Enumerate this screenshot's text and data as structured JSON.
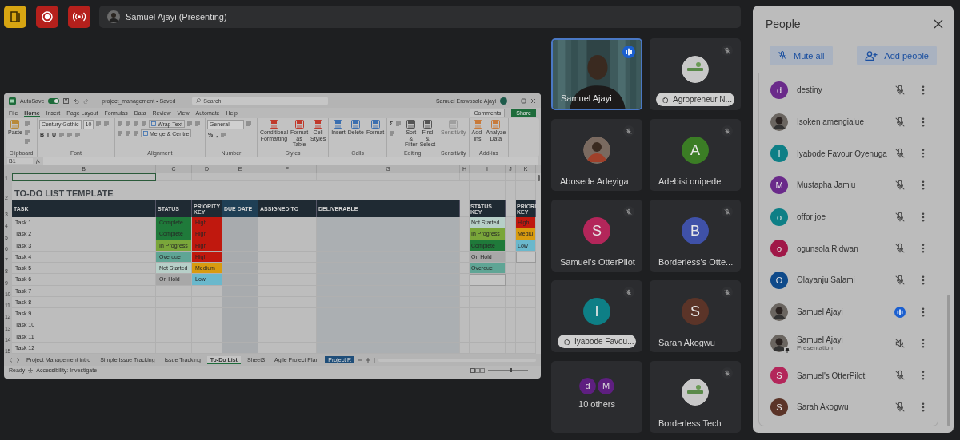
{
  "top_bar": {
    "presenter": "Samuel Ajayi (Presenting)"
  },
  "shared_screen": {
    "title_bar": {
      "autosave": "AutoSave",
      "autosave_on": true,
      "file_name": "project_management • Saved",
      "search_placeholder": "Search",
      "user": "Samuel Erowosale Ajayi"
    },
    "menu_tabs": [
      {
        "label": "File",
        "selected": false
      },
      {
        "label": "Home",
        "selected": true
      },
      {
        "label": "Insert",
        "selected": false
      },
      {
        "label": "Page Layout",
        "selected": false
      },
      {
        "label": "Formulas",
        "selected": false
      },
      {
        "label": "Data",
        "selected": false
      },
      {
        "label": "Review",
        "selected": false
      },
      {
        "label": "View",
        "selected": false
      },
      {
        "label": "Automate",
        "selected": false
      },
      {
        "label": "Help",
        "selected": false
      }
    ],
    "comments": "Comments",
    "share": "Share",
    "ribbon": [
      {
        "name": "Clipboard",
        "disabled": false,
        "items": [
          {
            "kind": "large",
            "label": "Paste"
          },
          {
            "kind": "icon"
          },
          {
            "kind": "icon"
          },
          {
            "kind": "icon"
          }
        ]
      },
      {
        "name": "Font",
        "disabled": false,
        "items": [
          {
            "kind": "dropdown",
            "label": "Century Gothic"
          },
          {
            "kind": "dropdown",
            "label": "10"
          },
          {
            "kind": "icon"
          },
          {
            "kind": "icon"
          },
          {
            "kind": "toggle",
            "label": "B"
          },
          {
            "kind": "toggle",
            "label": "I"
          },
          {
            "kind": "toggle",
            "label": "U"
          },
          {
            "kind": "icon"
          },
          {
            "kind": "icon"
          },
          {
            "kind": "icon"
          }
        ]
      },
      {
        "name": "Alignment",
        "disabled": false,
        "items": [
          {
            "kind": "icon"
          },
          {
            "kind": "icon"
          },
          {
            "kind": "icon"
          },
          {
            "kind": "icon"
          },
          {
            "kind": "small",
            "label": "Wrap Text"
          },
          {
            "kind": "icon"
          },
          {
            "kind": "icon"
          },
          {
            "kind": "icon"
          },
          {
            "kind": "icon"
          },
          {
            "kind": "icon"
          },
          {
            "kind": "small",
            "label": "Merge & Centre"
          }
        ]
      },
      {
        "name": "Number",
        "disabled": false,
        "items": [
          {
            "kind": "dropdown",
            "label": "General"
          },
          {
            "kind": "icon"
          },
          {
            "kind": "symbol",
            "label": "%"
          },
          {
            "kind": "symbol",
            "label": ","
          },
          {
            "kind": "icon"
          }
        ]
      },
      {
        "name": "Styles",
        "disabled": false,
        "items": [
          {
            "kind": "large",
            "label": "Conditional Formatting"
          },
          {
            "kind": "large",
            "label": "Format as Table"
          },
          {
            "kind": "large",
            "label": "Cell Styles"
          }
        ]
      },
      {
        "name": "Cells",
        "disabled": false,
        "items": [
          {
            "kind": "large",
            "label": "Insert"
          },
          {
            "kind": "large",
            "label": "Delete"
          },
          {
            "kind": "large",
            "label": "Format"
          }
        ]
      },
      {
        "name": "Editing",
        "disabled": false,
        "items": [
          {
            "kind": "symbol",
            "label": "Σ"
          },
          {
            "kind": "icon"
          },
          {
            "kind": "icon"
          },
          {
            "kind": "large",
            "label": "Sort & Filter"
          },
          {
            "kind": "large",
            "label": "Find & Select"
          }
        ]
      },
      {
        "name": "Sensitivity",
        "disabled": true,
        "items": [
          {
            "kind": "large",
            "label": "Sensitivity"
          }
        ]
      },
      {
        "name": "Add-ins",
        "disabled": false,
        "items": [
          {
            "kind": "large",
            "label": "Add-ins"
          },
          {
            "kind": "large",
            "label": "Analyze Data"
          }
        ]
      }
    ],
    "formula_bar": {
      "name_box": "B1",
      "function_label": "fx"
    },
    "columns": [
      "B",
      "C",
      "D",
      "E",
      "F",
      "G",
      "H",
      "I",
      "J",
      "K"
    ],
    "row_numbers": [
      "1",
      "2",
      "3",
      "4",
      "5",
      "6",
      "7",
      "8",
      "9",
      "10",
      "11",
      "12",
      "13",
      "14",
      "15"
    ],
    "sheet": {
      "title": "TO-DO LIST TEMPLATE",
      "headers": [
        {
          "label": "TASK",
          "kind": "text"
        },
        {
          "label": "STATUS",
          "kind": "text"
        },
        {
          "label": "PRIORITY KEY",
          "kind": "text"
        },
        {
          "label": "DUE DATE",
          "kind": "date"
        },
        {
          "label": "ASSIGNED TO",
          "kind": "text"
        },
        {
          "label": "DELIVERABLE",
          "kind": "text"
        }
      ],
      "rows": [
        {
          "task": "Task 1",
          "status": {
            "label": "Complete",
            "color": "#1f7a3a"
          },
          "priority": {
            "label": "High",
            "color": "#c0180e"
          }
        },
        {
          "task": "Task 2",
          "status": {
            "label": "Complete",
            "color": "#1f7a3a"
          },
          "priority": {
            "label": "High",
            "color": "#c0180e"
          }
        },
        {
          "task": "Task 3",
          "status": {
            "label": "In Progress",
            "color": "#7aa63a"
          },
          "priority": {
            "label": "High",
            "color": "#c0180e"
          }
        },
        {
          "task": "Task 4",
          "status": {
            "label": "Overdue",
            "color": "#5fa595"
          },
          "priority": {
            "label": "High",
            "color": "#c0180e"
          }
        },
        {
          "task": "Task 5",
          "status": {
            "label": "Not Started",
            "color": "#b7cfc8"
          },
          "priority": {
            "label": "Medium",
            "color": "#d89b10"
          }
        },
        {
          "task": "Task 6",
          "status": {
            "label": "On Hold",
            "color": "#a8a8a8"
          },
          "priority": {
            "label": "Low",
            "color": "#6ab8cc"
          }
        },
        {
          "task": "Task 7"
        },
        {
          "task": "Task 8"
        },
        {
          "task": "Task 9"
        },
        {
          "task": "Task 10"
        },
        {
          "task": "Task 11"
        },
        {
          "task": "Task 12"
        }
      ],
      "status_key": {
        "header": "STATUS KEY",
        "items": [
          {
            "label": "Not Started",
            "color": "#b7cfc8"
          },
          {
            "label": "In Progress",
            "color": "#7aa63a"
          },
          {
            "label": "Complete",
            "color": "#1f7a3a"
          },
          {
            "label": "On Hold",
            "color": "#a8a8a8"
          },
          {
            "label": "Overdue",
            "color": "#5fa595"
          }
        ]
      },
      "priority_key": {
        "header": "PRIORI KEY",
        "items": [
          {
            "label": "High",
            "color": "#c0180e"
          },
          {
            "label": "Mediu",
            "color": "#d89b10"
          },
          {
            "label": "Low",
            "color": "#6ab8cc"
          }
        ]
      }
    },
    "sheet_tabs": [
      {
        "label": "Project Management intro",
        "selected": false
      },
      {
        "label": "Simple Issue Tracking",
        "selected": false
      },
      {
        "label": "Issue Tracking",
        "selected": false
      },
      {
        "label": "To-Do List",
        "selected": true
      },
      {
        "label": "Sheet3",
        "selected": false
      },
      {
        "label": "Agile Project Plan",
        "selected": false
      },
      {
        "label": "Project R",
        "selected": false,
        "color": "#1f4e79"
      }
    ],
    "status_bar": {
      "ready": "Ready",
      "accessibility": "Accessibility: Investigate",
      "zoom_slider": {
        "level": 0.55
      }
    }
  },
  "tiles": [
    {
      "kind": "video",
      "name": "Samuel Ajayi",
      "speaking": true,
      "muted": false,
      "hand_raised": false
    },
    {
      "kind": "logo",
      "name": "Agropreneur N...",
      "speaking": false,
      "muted": true,
      "hand_raised": true
    },
    {
      "name": "Abosede Adeyiga",
      "speaking": false,
      "muted": true,
      "hand_raised": false
    },
    {
      "kind": "initial",
      "name": "Adebisi onipede",
      "initial": "A",
      "color": "#3b7d25",
      "speaking": false,
      "muted": true,
      "hand_raised": false
    },
    {
      "kind": "initial",
      "name": "Samuel's OtterPilot",
      "initial": "S",
      "color": "#b3265a",
      "speaking": false,
      "muted": true,
      "hand_raised": false
    },
    {
      "kind": "initial",
      "name": "Borderless's Otte...",
      "initial": "B",
      "color": "#3f51a8",
      "speaking": false,
      "muted": true,
      "hand_raised": false
    },
    {
      "kind": "initial",
      "name": "Iyabode Favou...",
      "initial": "I",
      "color": "#0e7f86",
      "speaking": false,
      "muted": true,
      "hand_raised": true
    },
    {
      "kind": "initial",
      "name": "Sarah Akogwu",
      "initial": "S",
      "color": "#5b3428",
      "speaking": false,
      "muted": true,
      "hand_raised": false
    },
    {
      "kind": "group",
      "name": "10 others",
      "initials": [
        {
          "initial": "d",
          "color": "#5e1f80"
        },
        {
          "initial": "M",
          "color": "#5e1f80"
        }
      ],
      "speaking": false,
      "muted": false,
      "hand_raised": false
    },
    {
      "kind": "logo",
      "name": "Borderless Tech",
      "speaking": false,
      "muted": true,
      "hand_raised": false
    }
  ],
  "people": {
    "title": "People",
    "mute_all": "Mute all",
    "add_people": "Add people",
    "list": [
      {
        "kind": "participant",
        "name": "destiny",
        "avatar": {
          "kind": "initial",
          "initial": "d",
          "color": "#6a2a8a"
        },
        "muted": true
      },
      {
        "kind": "participant",
        "name": "Isoken amengialue",
        "muted": true
      },
      {
        "kind": "participant",
        "name": "Iyabode Favour Oyenuga",
        "avatar": {
          "kind": "initial",
          "initial": "I",
          "color": "#0e7f86"
        },
        "muted": true
      },
      {
        "kind": "participant",
        "name": "Mustapha Jamiu",
        "avatar": {
          "kind": "initial",
          "initial": "M",
          "color": "#6a2a8a"
        },
        "muted": true
      },
      {
        "kind": "participant",
        "name": "offor joe",
        "avatar": {
          "kind": "initial",
          "initial": "o",
          "color": "#0e7f86"
        },
        "muted": true
      },
      {
        "kind": "participant",
        "name": "ogunsola Ridwan",
        "avatar": {
          "kind": "initial",
          "initial": "o",
          "color": "#a01848"
        },
        "muted": true
      },
      {
        "kind": "participant",
        "name": "Olayanju Salami",
        "avatar": {
          "kind": "initial",
          "initial": "O",
          "color": "#0f4a8a"
        },
        "muted": true
      },
      {
        "kind": "participant",
        "name": "Samuel Ajayi",
        "muted": false
      },
      {
        "kind": "presentation",
        "name": "Samuel Ajayi",
        "subtitle": "Presentation",
        "muted": true
      },
      {
        "kind": "participant",
        "name": "Samuel's OtterPilot",
        "avatar": {
          "kind": "initial",
          "initial": "S",
          "color": "#b3265a"
        },
        "muted": true
      },
      {
        "kind": "participant",
        "name": "Sarah Akogwu",
        "avatar": {
          "kind": "initial",
          "initial": "S",
          "color": "#5b3428"
        },
        "muted": true
      }
    ]
  }
}
